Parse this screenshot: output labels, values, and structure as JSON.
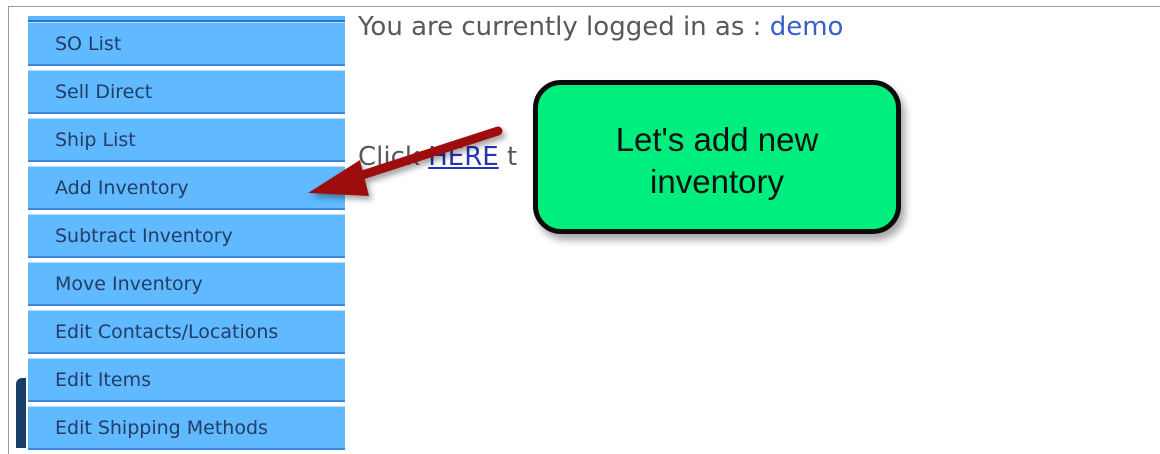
{
  "sidebar": {
    "items": [
      {
        "label": "SO List",
        "name": "sidebar-item-so-list"
      },
      {
        "label": "Sell Direct",
        "name": "sidebar-item-sell-direct"
      },
      {
        "label": "Ship List",
        "name": "sidebar-item-ship-list"
      },
      {
        "label": "Add Inventory",
        "name": "sidebar-item-add-inventory"
      },
      {
        "label": "Subtract Inventory",
        "name": "sidebar-item-subtract-inventory"
      },
      {
        "label": "Move Inventory",
        "name": "sidebar-item-move-inventory"
      },
      {
        "label": "Edit Contacts/Locations",
        "name": "sidebar-item-edit-contacts-locations"
      },
      {
        "label": "Edit Items",
        "name": "sidebar-item-edit-items"
      },
      {
        "label": "Edit Shipping Methods",
        "name": "sidebar-item-edit-shipping-methods"
      }
    ]
  },
  "main": {
    "login_prefix": "You are currently logged in as : ",
    "username": "demo",
    "click_prefix": "Click ",
    "here_link": "HERE",
    "click_suffix": " t"
  },
  "callout": {
    "text": "Let's add new inventory"
  },
  "colors": {
    "nav_background": "#61b9ff",
    "callout_background": "#00ee7d",
    "arrow": "#9e0d0d"
  }
}
